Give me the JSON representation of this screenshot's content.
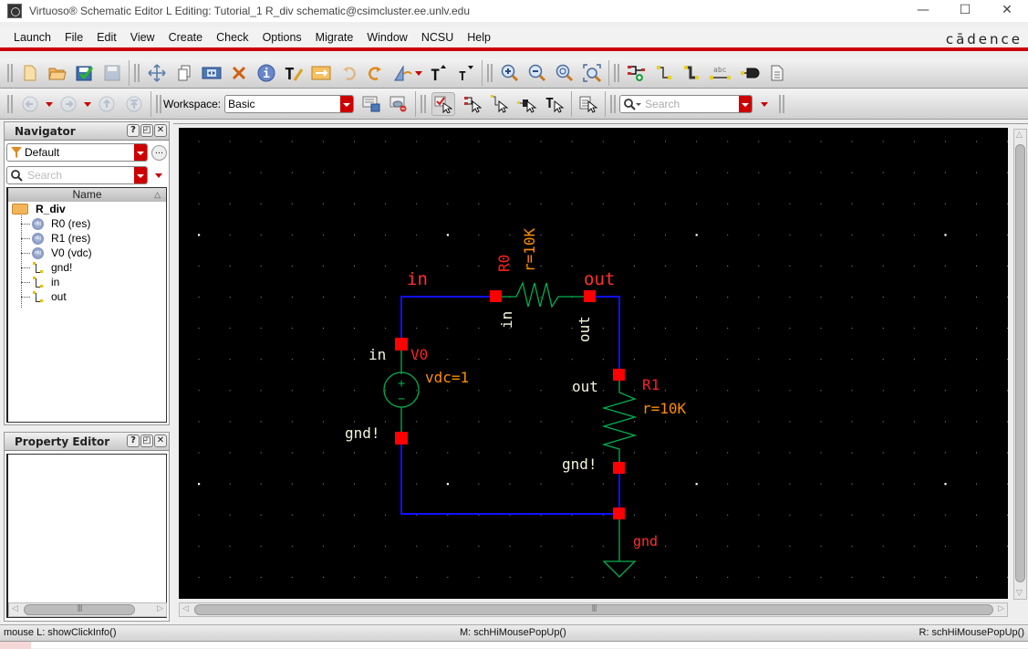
{
  "window": {
    "title": "Virtuoso® Schematic Editor L Editing: Tutorial_1 R_div schematic@csimcluster.ee.unlv.edu",
    "controls": {
      "minimize": "—",
      "maximize": "☐",
      "close": "✕"
    }
  },
  "menubar": {
    "items": [
      "Launch",
      "File",
      "Edit",
      "View",
      "Create",
      "Check",
      "Options",
      "Migrate",
      "Window",
      "NCSU",
      "Help"
    ],
    "brand": "cādence"
  },
  "toolbar1": {
    "buttons": [
      {
        "name": "new-icon",
        "glyph": "🗋"
      },
      {
        "name": "open-icon",
        "glyph": "📂"
      },
      {
        "name": "check-and-save-icon",
        "glyph": "✔"
      },
      {
        "name": "save-icon",
        "glyph": "💾",
        "disabled": true
      },
      {
        "name": "move-icon",
        "glyph": "✥"
      },
      {
        "name": "copy-icon",
        "glyph": "❐"
      },
      {
        "name": "stretch-icon",
        "glyph": "◀▶"
      },
      {
        "name": "delete-icon",
        "glyph": "✖"
      },
      {
        "name": "properties-icon",
        "glyph": "ⓘ"
      },
      {
        "name": "edit-text-icon",
        "glyph": "T"
      },
      {
        "name": "cross-probe-icon",
        "glyph": "⇄"
      },
      {
        "name": "undo-icon",
        "glyph": "↶",
        "disabled": true
      },
      {
        "name": "redo-icon",
        "glyph": "↷"
      },
      {
        "name": "rotate-icon",
        "glyph": "◭"
      },
      {
        "name": "increase-font-icon",
        "glyph": "T˄"
      },
      {
        "name": "decrease-font-icon",
        "glyph": "T˅"
      },
      {
        "name": "zoom-in-icon",
        "glyph": "⊕"
      },
      {
        "name": "zoom-out-icon",
        "glyph": "⊖"
      },
      {
        "name": "zoom-fit-icon",
        "glyph": "◎"
      },
      {
        "name": "zoom-area-icon",
        "glyph": "⬚"
      },
      {
        "name": "add-instance-icon",
        "glyph": "⊣"
      },
      {
        "name": "add-wire-icon",
        "glyph": "┐"
      },
      {
        "name": "add-wide-wire-icon",
        "glyph": "┓"
      },
      {
        "name": "add-wire-name-icon",
        "glyph": "abc"
      },
      {
        "name": "add-pin-icon",
        "glyph": "▶"
      },
      {
        "name": "add-note-icon",
        "glyph": "☷"
      }
    ]
  },
  "toolbar2": {
    "workspace_label": "Workspace:",
    "workspace_value": "Basic",
    "search_placeholder": "Search"
  },
  "navigator": {
    "title": "Navigator",
    "filter": "Default",
    "search_placeholder": "Search",
    "column_header": "Name",
    "root": "R_div",
    "items": [
      {
        "label": "R0 (res)",
        "type": "instance"
      },
      {
        "label": "R1 (res)",
        "type": "instance"
      },
      {
        "label": "V0 (vdc)",
        "type": "instance"
      },
      {
        "label": "gnd!",
        "type": "net"
      },
      {
        "label": "in",
        "type": "net"
      },
      {
        "label": "out",
        "type": "net"
      }
    ]
  },
  "property_editor": {
    "title": "Property Editor"
  },
  "dock_buttons": {
    "help": "?",
    "float": "◰",
    "close": "✕"
  },
  "schematic": {
    "colors": {
      "wire": "#0000ff",
      "device": "#00b050",
      "pin": "#ff0000",
      "inst_name": "#ff2020",
      "param": "#ff8c00",
      "net_label": "#ff3030",
      "pin_label": "#f5f5dc",
      "grid": "#aaaaaa"
    },
    "net_labels": {
      "in": "in",
      "out": "out",
      "gnd": "gnd"
    },
    "R0": {
      "name": "R0",
      "param": "r=10K",
      "pin_a": "in",
      "pin_b": "out"
    },
    "R1": {
      "name": "R1",
      "param": "r=10K",
      "pin_a": "out",
      "pin_b": "gnd!"
    },
    "V0": {
      "name": "V0",
      "param": "vdc=1",
      "pin_a": "in",
      "pin_b": "gnd!",
      "plus": "+",
      "minus": "−"
    }
  },
  "status": {
    "left": "mouse L: showClickInfo()",
    "middle": "M: schHiMousePopUp()",
    "right": "R: schHiMousePopUp()"
  }
}
